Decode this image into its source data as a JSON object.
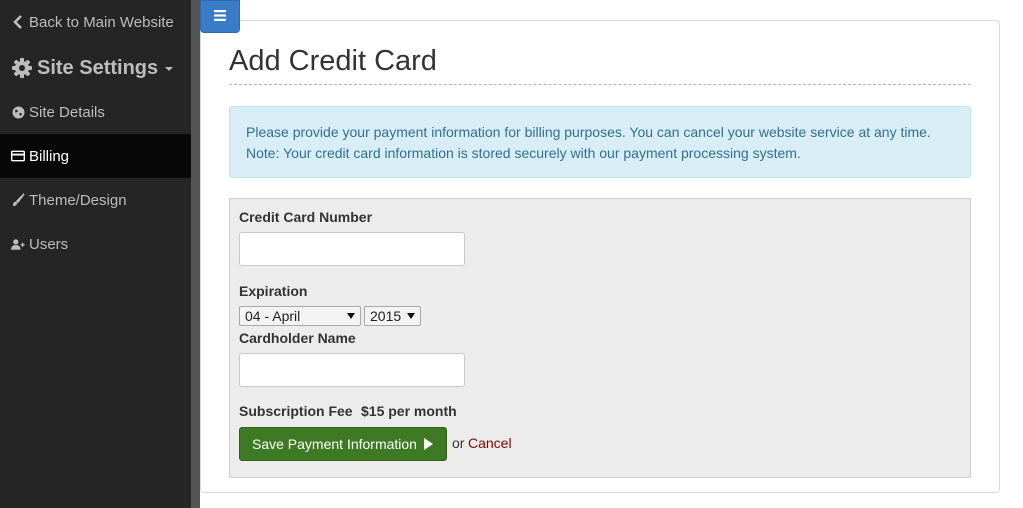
{
  "sidebar": {
    "back_label": "Back to Main Website",
    "title": "Site Settings",
    "items": [
      {
        "label": "Site Details",
        "icon": "globe-icon"
      },
      {
        "label": "Billing",
        "icon": "credit-card-icon",
        "active": true
      },
      {
        "label": "Theme/Design",
        "icon": "brush-icon"
      },
      {
        "label": "Users",
        "icon": "add-user-icon"
      }
    ]
  },
  "main": {
    "title": "Add Credit Card",
    "alert": {
      "line1": "Please provide your payment information for billing purposes. You can cancel your website service at any time.",
      "line2": "Note: Your credit card information is stored securely with our payment processing system."
    },
    "form": {
      "card_number_label": "Credit Card Number",
      "card_number_value": "",
      "expiration_label": "Expiration",
      "month_selected": "04 - April",
      "year_selected": "2015",
      "cardholder_label": "Cardholder Name",
      "cardholder_value": "",
      "fee_label": "Subscription Fee",
      "fee_value": "$15 per month",
      "save_label": "Save Payment Information",
      "or_text": "or",
      "cancel_label": "Cancel"
    }
  },
  "colors": {
    "sidebar_bg": "#252525",
    "sidebar_active_bg": "#080808",
    "toggle_bg": "#3a7cc8",
    "alert_bg": "#d9edf7",
    "alert_text": "#31708f",
    "save_button_bg": "#3e7a23",
    "cancel_link": "#8b0000"
  }
}
